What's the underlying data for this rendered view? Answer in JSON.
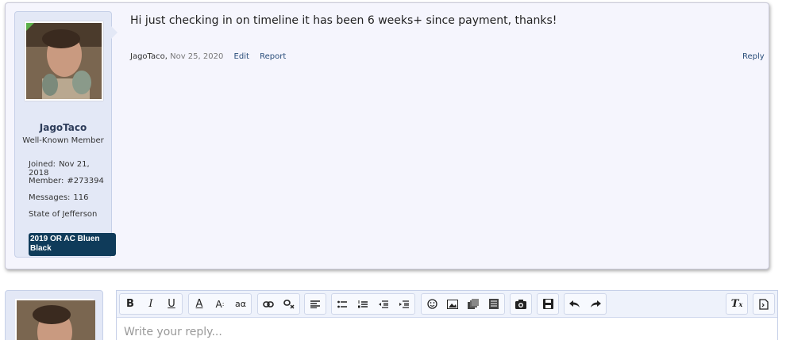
{
  "post": {
    "message": "Hi just checking in on timeline it has been 6 weeks+ since payment, thanks!",
    "author": "JagoTaco",
    "date": "Nov 25, 2020",
    "edit_label": "Edit",
    "report_label": "Report",
    "reply_label": "Reply"
  },
  "user": {
    "name": "JagoTaco",
    "title": "Well-Known Member",
    "joined_label": "Joined:",
    "joined": "Nov 21, 2018",
    "member_label": "Member:",
    "member": "#273394",
    "messages_label": "Messages:",
    "messages": "116",
    "location": "State of Jefferson",
    "banner": "2019 OR AC Bluen Black",
    "banner_color": "#0f3b5a"
  },
  "editor": {
    "placeholder": "Write your reply...",
    "toolbar_icons": [
      "bold-icon",
      "italic-icon",
      "underline-icon",
      "text-color-icon",
      "font-size-icon",
      "font-family-icon",
      "link-icon",
      "unlink-icon",
      "align-icon",
      "bullet-list-icon",
      "numbered-list-icon",
      "outdent-icon",
      "indent-icon",
      "smilie-icon",
      "image-icon",
      "media-icon",
      "quote-icon",
      "camera-icon",
      "save-draft-icon",
      "undo-icon",
      "redo-icon",
      "remove-format-icon",
      "toggle-bbcode-icon"
    ]
  }
}
